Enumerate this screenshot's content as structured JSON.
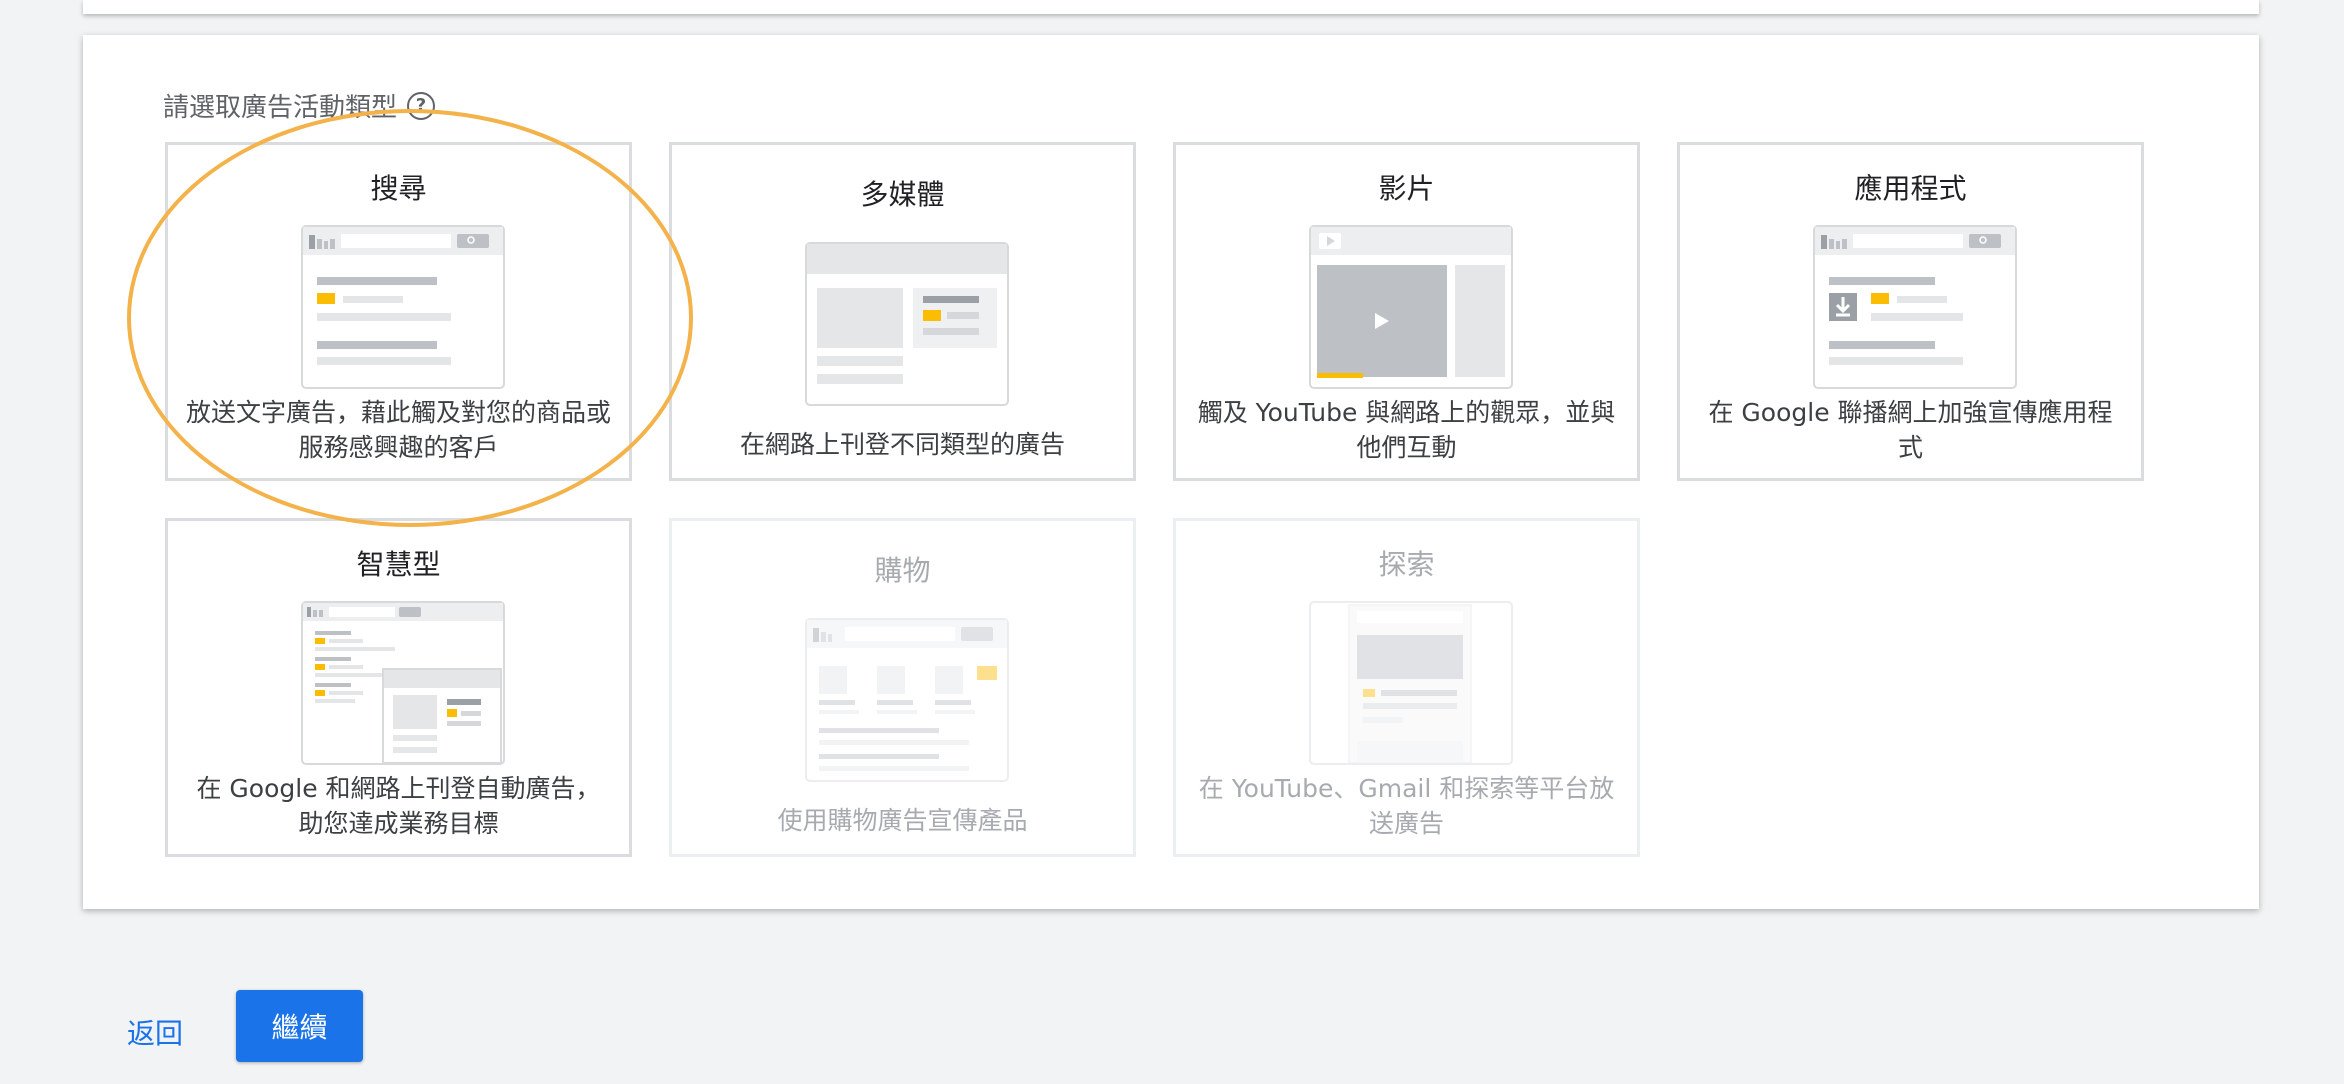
{
  "section_label": "請選取廣告活動類型",
  "cards": [
    {
      "title": "搜尋",
      "desc": "放送文字廣告，藉此觸及對您的商品或服務感興趣的客戶"
    },
    {
      "title": "多媒體",
      "desc": "在網路上刊登不同類型的廣告"
    },
    {
      "title": "影片",
      "desc": "觸及 YouTube 與網路上的觀眾，並與他們互動"
    },
    {
      "title": "應用程式",
      "desc": "在 Google 聯播網上加強宣傳應用程式"
    },
    {
      "title": "智慧型",
      "desc": "在 Google 和網路上刊登自動廣告，助您達成業務目標"
    },
    {
      "title": "購物",
      "desc": "使用購物廣告宣傳產品"
    },
    {
      "title": "探索",
      "desc": "在 YouTube、Gmail 和探索等平台放送廣告"
    }
  ],
  "disabled_cards": [
    "購物",
    "探索"
  ],
  "actions": {
    "back_label": "返回",
    "continue_label": "繼續"
  },
  "colors": {
    "accent": "#1a73e8",
    "highlight": "#f3b24a",
    "ad_yellow": "#fbbc04"
  }
}
